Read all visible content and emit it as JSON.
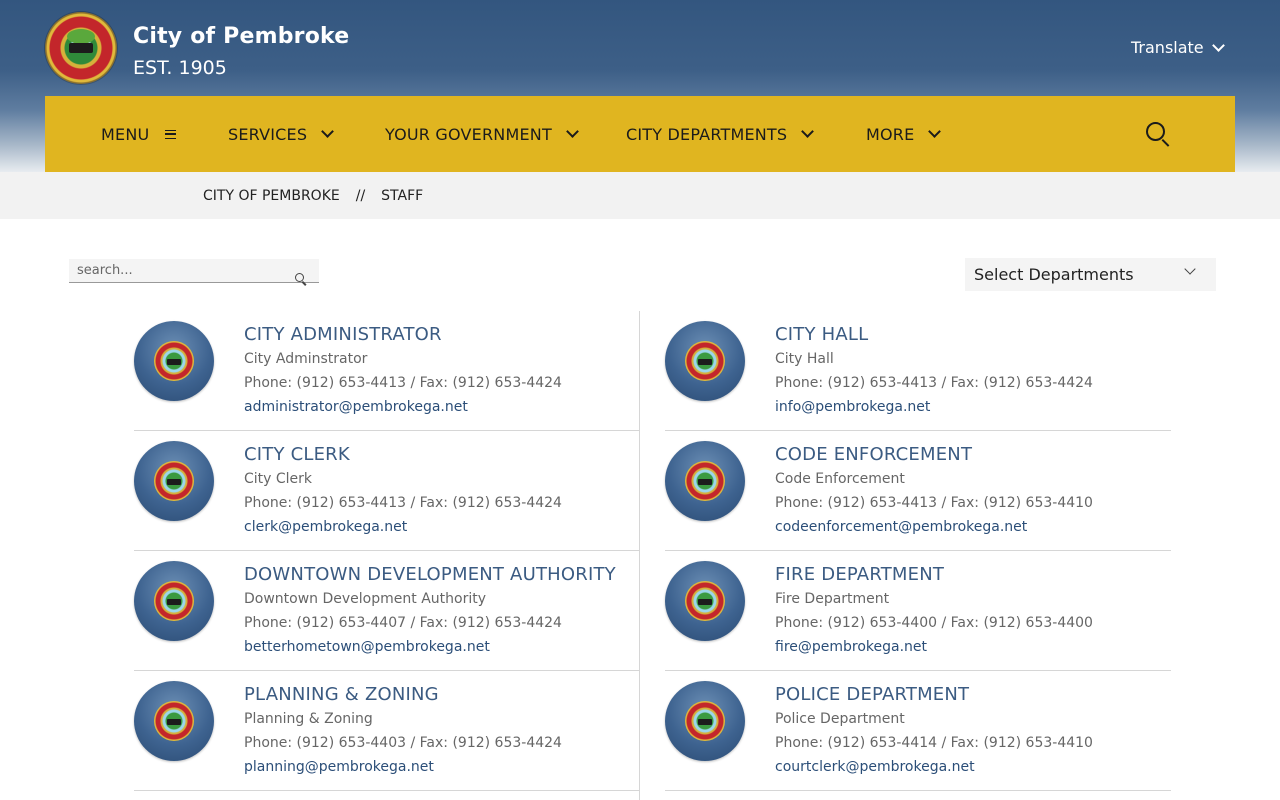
{
  "header": {
    "title": "City of Pembroke",
    "subtitle": "EST. 1905",
    "translate_label": "Translate",
    "seal_icon": "city-seal-logo"
  },
  "nav": {
    "menu": "MENU",
    "services": "SERVICES",
    "your_government": "YOUR GOVERNMENT",
    "city_departments": "CITY DEPARTMENTS",
    "more": "MORE",
    "search_icon": "search-icon"
  },
  "breadcrumb": {
    "home": "CITY OF PEMBROKE",
    "separator": "//",
    "current": "STAFF"
  },
  "toolbar": {
    "search_placeholder": "search...",
    "department_select": "Select Departments"
  },
  "staff": [
    {
      "title": "CITY ADMINISTRATOR",
      "role": "City Adminstrator",
      "phone": "Phone: (912) 653-4413 / Fax: (912) 653-4424",
      "email": "administrator@pembrokega.net"
    },
    {
      "title": "CITY HALL",
      "role": "City Hall",
      "phone": "Phone: (912) 653-4413 / Fax: (912) 653-4424",
      "email": "info@pembrokega.net"
    },
    {
      "title": "CITY CLERK",
      "role": "City Clerk",
      "phone": "Phone: (912) 653-4413 / Fax: (912) 653-4424",
      "email": "clerk@pembrokega.net"
    },
    {
      "title": "CODE ENFORCEMENT",
      "role": "Code Enforcement",
      "phone": "Phone: (912) 653-4413 / Fax: (912) 653-4410",
      "email": "codeenforcement@pembrokega.net"
    },
    {
      "title": "DOWNTOWN DEVELOPMENT AUTHORITY",
      "role": "Downtown Development Authority",
      "phone": "Phone: (912) 653-4407 / Fax: (912) 653-4424",
      "email": "betterhometown@pembrokega.net"
    },
    {
      "title": "FIRE DEPARTMENT",
      "role": "Fire Department",
      "phone": "Phone: (912) 653-4400 / Fax: (912) 653-4400",
      "email": "fire@pembrokega.net"
    },
    {
      "title": "PLANNING & ZONING",
      "role": "Planning & Zoning",
      "phone": "Phone: (912) 653-4403 / Fax: (912) 653-4424",
      "email": "planning@pembrokega.net"
    },
    {
      "title": "POLICE DEPARTMENT",
      "role": "Police Department",
      "phone": "Phone: (912) 653-4414 / Fax: (912) 653-4410",
      "email": "courtclerk@pembrokega.net"
    }
  ],
  "colors": {
    "header_blue": "#33567f",
    "nav_gold": "#e0b520",
    "title_blue": "#3b5b82",
    "link_blue": "#2b4e78"
  }
}
